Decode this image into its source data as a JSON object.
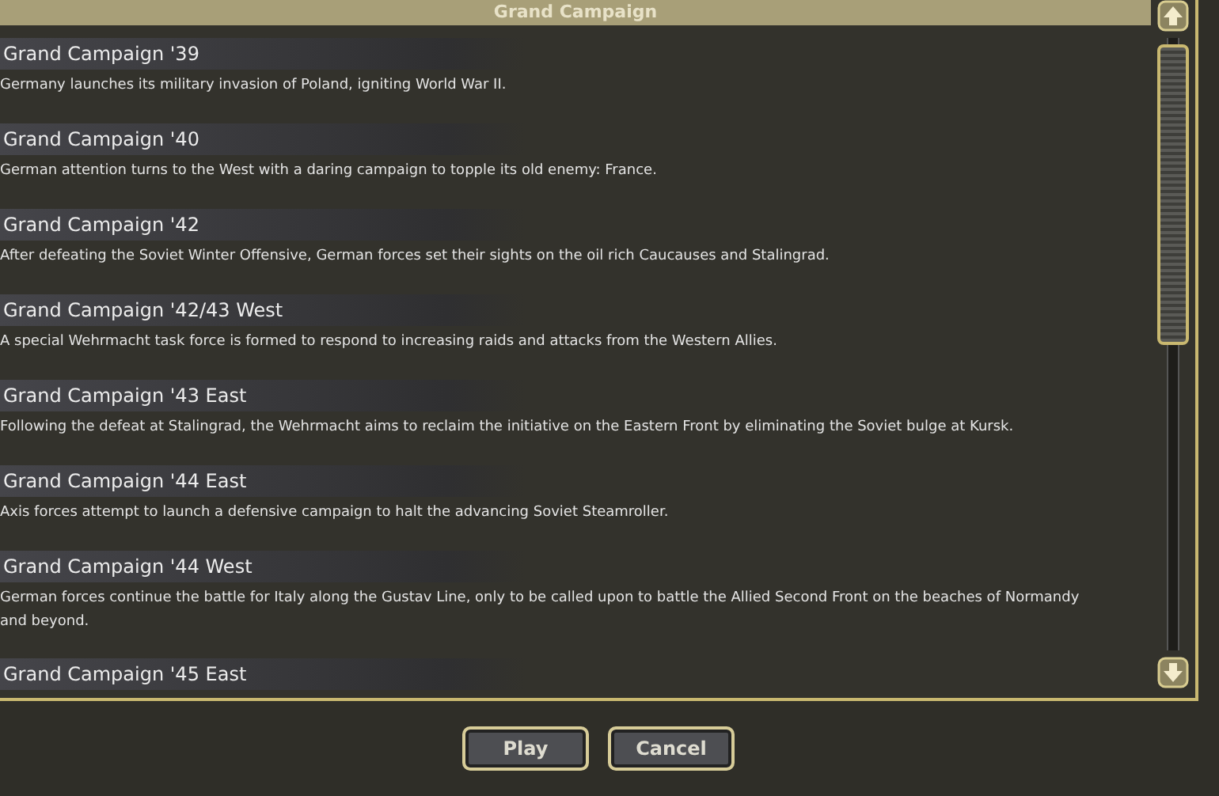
{
  "header": {
    "title": "Grand Campaign"
  },
  "campaigns": [
    {
      "title": "Grand Campaign '39",
      "description": "Germany launches its military invasion of Poland, igniting World War II."
    },
    {
      "title": "Grand Campaign '40",
      "description": "German attention turns to the West with a daring campaign to topple its old enemy: France."
    },
    {
      "title": "Grand Campaign '42",
      "description": "After defeating the Soviet Winter Offensive, German forces set their sights on the oil rich Caucauses and Stalingrad."
    },
    {
      "title": "Grand Campaign '42/43 West",
      "description": "A special Wehrmacht task force is formed to respond to increasing raids and attacks from the Western Allies."
    },
    {
      "title": "Grand Campaign '43 East",
      "description": "Following the defeat at Stalingrad, the Wehrmacht aims to reclaim the initiative on the Eastern Front by eliminating the Soviet bulge at Kursk."
    },
    {
      "title": "Grand Campaign '44 East",
      "description": "Axis forces attempt to launch a defensive campaign to halt the advancing Soviet Steamroller."
    },
    {
      "title": "Grand Campaign '44 West",
      "description": "German forces continue the battle for Italy along the Gustav Line, only to be called upon to battle the Allied Second Front on the beaches of Normandy and beyond."
    },
    {
      "title": "Grand Campaign '45 East"
    }
  ],
  "buttons": [
    "Play",
    "Cancel"
  ]
}
